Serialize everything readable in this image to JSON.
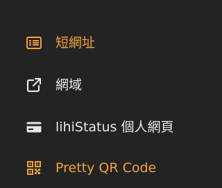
{
  "theme": {
    "background": "#232323",
    "accent": "#F2A23C",
    "text": "#E6E6E6"
  },
  "menu": {
    "items": [
      {
        "label": "短網址",
        "icon": "list-alt-icon",
        "state": "active"
      },
      {
        "label": "網域",
        "icon": "external-link-icon",
        "state": "normal"
      },
      {
        "label": "lihiStatus 個人網頁",
        "icon": "credit-card-icon",
        "state": "normal"
      },
      {
        "label": "Pretty QR Code",
        "icon": "qr-code-icon",
        "state": "active"
      }
    ]
  }
}
